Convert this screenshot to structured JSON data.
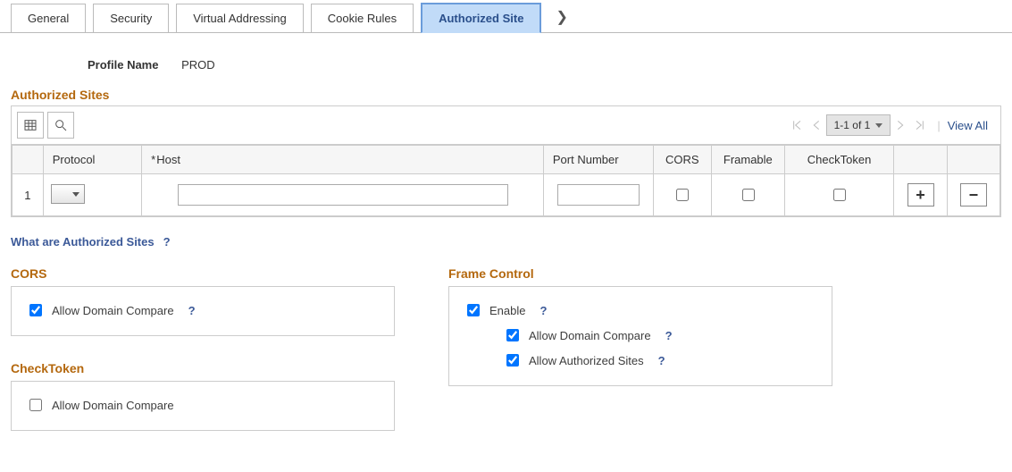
{
  "tabs": [
    "General",
    "Security",
    "Virtual Addressing",
    "Cookie Rules",
    "Authorized Site"
  ],
  "active_tab": "Authorized Site",
  "profile": {
    "label": "Profile Name",
    "value": "PROD"
  },
  "grid": {
    "title": "Authorized Sites",
    "pager": "1-1 of 1",
    "view_all": "View All",
    "columns": {
      "protocol": "Protocol",
      "host": "Host",
      "port": "Port Number",
      "cors": "CORS",
      "framable": "Framable",
      "checktoken": "CheckToken"
    },
    "rows": [
      {
        "n": "1",
        "protocol": "",
        "host": "",
        "port": "",
        "cors": false,
        "framable": false,
        "checktoken": false
      }
    ]
  },
  "help_link": "What are Authorized Sites",
  "cors": {
    "title": "CORS",
    "allow_dc": "Allow Domain Compare",
    "allow_dc_checked": true
  },
  "frame": {
    "title": "Frame Control",
    "enable": "Enable",
    "enable_checked": true,
    "allow_dc": "Allow Domain Compare",
    "allow_dc_checked": true,
    "allow_sites": "Allow Authorized Sites",
    "allow_sites_checked": true
  },
  "checktoken": {
    "title": "CheckToken",
    "allow_dc": "Allow Domain Compare",
    "allow_dc_checked": false
  },
  "glyphs": {
    "help": "?",
    "plus": "+",
    "minus": "−",
    "more": "❯"
  }
}
